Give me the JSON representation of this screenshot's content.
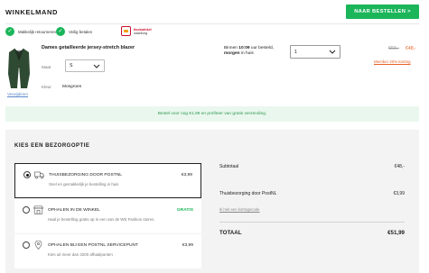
{
  "header": {
    "title": "WINKELMAND",
    "order_button": "NAAR BESTELLEN >"
  },
  "usps": [
    {
      "icon": "check-icon",
      "label": "Makkelijk retourneren"
    },
    {
      "icon": "check-icon",
      "label": "Veilig betalen"
    }
  ],
  "trustmark": {
    "line1": "thuiswinkel",
    "line2": "waarborg"
  },
  "product": {
    "name": "Dames getailleerde jersey-stretch blazer",
    "size_label": "Maat",
    "size_value": "S",
    "color_label": "Kleur",
    "color_value": "Mosgroen",
    "remove_label": "Verwijderen",
    "delivery_prefix": "Binnen ",
    "delivery_time": "10:09",
    "delivery_mid": " uur besteld,",
    "delivery_day": "morgen",
    "delivery_suffix": " in huis",
    "quantity": "1",
    "price_old": "€60,-",
    "price_new": "€48,-",
    "member_link": "Member 20% korting"
  },
  "shipping_banner": "Bestel voor nog €1,99 en profiteer van gratis verzending.",
  "delivery": {
    "title": "KIES EEN BEZORGOPTIE",
    "options": [
      {
        "title": "THUISBEZORGING DOOR POSTNL",
        "desc": "Snel en gemakkelijk je bestelling in huis",
        "price": "€3,99",
        "selected": true
      },
      {
        "title": "OPHALEN IN DE WINKEL",
        "desc": "Haal je bestelling gratis op in een van de WE Fashion stores",
        "price": "GRATIS",
        "selected": false
      },
      {
        "title": "OPHALEN BIJ EEN POSTNL SERVICEPUNT",
        "desc": "Kies uit meer dan 3200 afhaalpunten",
        "price": "€3,99",
        "selected": false
      }
    ]
  },
  "summary": {
    "subtotal_label": "Subtotaal",
    "subtotal_value": "€48,-",
    "shipping_label": "Thuisbezorging door PostNL",
    "shipping_value": "€3,99",
    "coupon_link": "Ik heb een kortingscode",
    "total_label": "TOTAAL",
    "total_value": "€51,99"
  },
  "colors": {
    "accent_green": "#1bb55a",
    "discount_orange": "#e8622a",
    "product_green": "#2f4a33"
  }
}
